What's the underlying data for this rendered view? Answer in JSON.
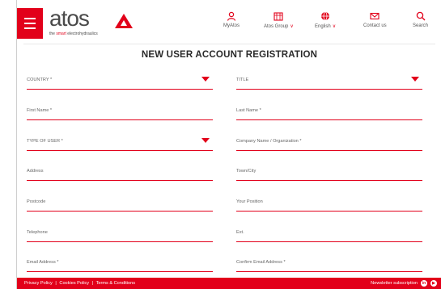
{
  "brand": {
    "logo_text": "atos",
    "tagline_prefix": "the ",
    "tagline_accent": "smart",
    "tagline_suffix": " electrohydraulics",
    "accent_color": "#e2001a"
  },
  "nav": {
    "items": [
      {
        "label": "MyAtos",
        "icon": "user-icon"
      },
      {
        "label": "Atos Group",
        "icon": "building-icon",
        "dropdown": true
      },
      {
        "label": "English",
        "icon": "globe-icon",
        "dropdown": true
      },
      {
        "label": "Contact us",
        "icon": "envelope-icon"
      },
      {
        "label": "Search",
        "icon": "search-icon"
      }
    ]
  },
  "page": {
    "title": "NEW USER ACCOUNT REGISTRATION"
  },
  "form": {
    "country": "COUNTRY *",
    "title": "TITLE",
    "first_name": "First Name *",
    "last_name": "Last Name *",
    "type_of_user": "TYPE OF USER *",
    "company": "Company Name / Organization *",
    "address": "Address",
    "town": "Town/City",
    "postcode": "Postcode",
    "position": "Your Position",
    "telephone": "Telephone",
    "ext": "Ext.",
    "email": "Email Address *",
    "confirm_email": "Confirm Email Address *"
  },
  "footer": {
    "privacy": "Privacy Policy",
    "cookies": "Cookies Policy",
    "terms": "Terms & Conditions",
    "separator": "|",
    "newsletter": "Newsletter subscription",
    "social": [
      "linkedin-icon",
      "youtube-icon"
    ]
  }
}
